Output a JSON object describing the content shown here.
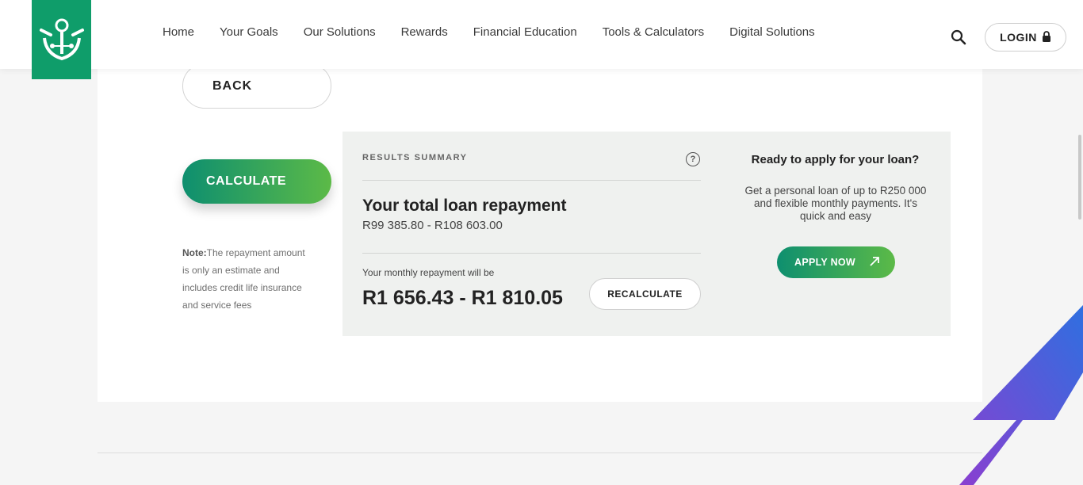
{
  "header": {
    "nav": [
      "Home",
      "Your Goals",
      "Our Solutions",
      "Rewards",
      "Financial Education",
      "Tools & Calculators",
      "Digital Solutions"
    ],
    "login_label": "LOGIN"
  },
  "calculator": {
    "back_label": "BACK",
    "calculate_label": "CALCULATE",
    "note_bold": "Note:",
    "note_text": "The repayment amount is only an estimate and includes credit life insurance and service fees"
  },
  "results": {
    "summary_label": "RESULTS SUMMARY",
    "help_glyph": "?",
    "total_title": "Your total loan repayment",
    "total_range": "R99 385.80 - R108 603.00",
    "monthly_label": "Your monthly repayment will be",
    "monthly_value": "R1 656.43 - R1 810.05",
    "recalculate_label": "RECALCULATE"
  },
  "apply": {
    "title": "Ready to apply for your loan?",
    "description": "Get a personal loan of up to R250 000 and flexible monthly payments. It's quick and easy",
    "button_label": "APPLY NOW"
  },
  "colors": {
    "brand_green": "#0f9d6a",
    "gradient_start": "#0e8f6f",
    "gradient_end": "#5cba47",
    "panel_bg": "#eff1ef"
  },
  "icons": [
    "search-icon",
    "lock-icon",
    "help-icon",
    "arrow-up-right-icon"
  ]
}
